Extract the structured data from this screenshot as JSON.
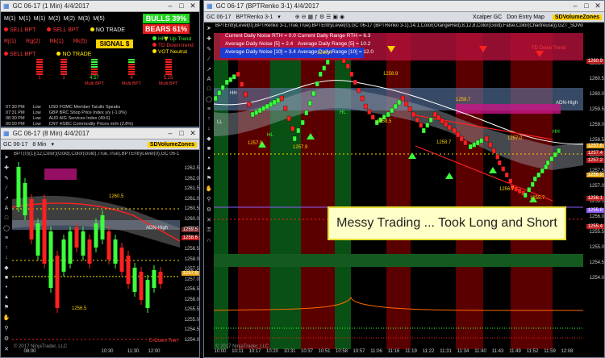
{
  "analyzer": {
    "title": "GC 06-17 (1 Min)  4/4/2017",
    "columns": [
      "M(1)",
      "M(1)",
      "M(1)",
      "M(2)",
      "M(2)",
      "M(3)",
      "M(5)"
    ],
    "rows": [
      {
        "items": [
          {
            "t": "SELL BPT",
            "c": "red"
          },
          {
            "t": "SELL BPT",
            "c": "red"
          },
          {
            "t": "NO TRADE",
            "c": "yel"
          }
        ]
      },
      {
        "items": [
          {
            "t": "Rj(1)",
            "c": "red"
          },
          {
            "t": "Rg(2)",
            "c": "red"
          },
          {
            "t": "Rk(1)",
            "c": "red"
          },
          {
            "t": "Rk(5)",
            "c": "red"
          }
        ]
      },
      {
        "items": [
          {
            "t": "SELL BPT",
            "c": "red"
          },
          {
            "t": "NO TRADE",
            "c": "yel"
          }
        ]
      }
    ],
    "bulls": "BULLS 39%",
    "bears": "BEARS 61%",
    "signal": "SIGNAL",
    "hft_up": "HFT Up Trend",
    "td_down": "TD Down trend",
    "vot_neutral": "VOT Neutral",
    "bar_values": [
      "1",
      "1",
      "4.57",
      "4",
      "5.25"
    ],
    "bar_labels": [
      "",
      "",
      "Multi BPT",
      "Multi BPT",
      "Multi BPT"
    ],
    "news": [
      [
        "07:30 PM",
        "Low",
        "USD FOMC Member Tarullo Speaks"
      ],
      [
        "07:31 PM",
        "Low",
        "GBP BRC Shop Price Index y/y (-1.0%)"
      ],
      [
        "08:30 PM",
        "Low",
        "AUD AIG Services Index (49.6)"
      ],
      [
        "09:00 PM",
        "Low",
        "CNY HSBC Commodity Prices m/m (2.8%)"
      ]
    ]
  },
  "small_chart": {
    "title": "GC 06-17 (8 Min)  4/4/2017",
    "toolbar": [
      "GC 06-17",
      "8 Min",
      "▾"
    ],
    "indicator": "BPT(0)(1)(12,Color)(Gold),Color(Gold),True,True),BPTEntryLevel(0),GC 06-17",
    "sdv": "SDVolumeZones",
    "prices": [
      "1262.5",
      "1262.0",
      "1261.5",
      "1261.0",
      "1260.5",
      "1260.0",
      "1259.5",
      "1259.0",
      "1258.5",
      "1258.0",
      "1257.5",
      "1257.0",
      "1256.5",
      "1256.0",
      "1255.5",
      "1255.0",
      "1254.5",
      "1254.0"
    ],
    "price_boxes": [
      {
        "v": "1259.5",
        "bg": "#7a2a2a"
      },
      {
        "v": "1258.6",
        "bg": "#b91c1c"
      },
      {
        "v": "1257.9",
        "bg": "#e8a81c"
      }
    ],
    "labels": {
      "adn_high": "ADN-High",
      "d_down": "D-Down Tren",
      "low": "1256.5",
      "mid": "1260.5"
    },
    "times": [
      "08:00",
      "10:30",
      "11:30",
      "12:00"
    ],
    "copyright": "© 2017 NinjaTrader, LLC"
  },
  "big_chart": {
    "title": "GC 06-17 (BPTRenko 3-1)  4/4/2017",
    "toolbar": [
      "GC 06-17",
      "BPTRenko 3-1",
      "▾"
    ],
    "xcalper": "Xcalper GC",
    "don_entry": "Don Entry Map",
    "sdv": "SDVolumeZones",
    "indicator": "BPTEntryLevel(0),BPTRenko 3-1,True,True),BPTEntryLevel(0),GC 06-17 (BPTRenko 3-1),14,1,Color(OrangeRed),8,12,8,Color(Gold),False,Color(Chartreuse)),GZT_SDVolumeZ",
    "noise": {
      "cur_noise": "Current Daily Noise RTH = 0.0",
      "cur_range": "Current Daily Range RTH = 6.3",
      "avg_noise5": "Average Daily Noise [5] = 2.4",
      "avg_range5": "Average Daily Range [5] = 10.2",
      "avg_noise10": "Average Daily Noise [10] = 3.4",
      "avg_range10": "Average Daily Range [10] = 12.0"
    },
    "prices": [
      "1261.0",
      "1260.5",
      "1260.0",
      "1259.5",
      "1259.0",
      "1258.5",
      "1258.0",
      "1257.5",
      "1257.0",
      "1256.5",
      "1256.0",
      "1255.5",
      "1255.0",
      "1254.5",
      "1254.0"
    ],
    "price_boxes": [
      {
        "v": "1260.9",
        "bg": "#b91c1c"
      },
      {
        "v": "1257.6",
        "bg": "#e8a81c"
      },
      {
        "v": "1257.4",
        "bg": "#b91c1c"
      },
      {
        "v": "1257.2",
        "bg": "#b91c1c"
      },
      {
        "v": "1256.9",
        "bg": "#e8a81c"
      },
      {
        "v": "1256.1",
        "bg": "#b91c1c"
      },
      {
        "v": "1255.8",
        "bg": "#8b5cf6"
      },
      {
        "v": "1255.4",
        "bg": "#b91c1c"
      }
    ],
    "labels": {
      "td_down": "TD Down Trend",
      "adn_high": "ADN-High",
      "hh": "HH",
      "hl": "HL",
      "hh2": "HH",
      "hl2": "HL",
      "ll": "LL",
      "p1": "1257.9",
      "p2": "1257.9",
      "p3": "1258.5",
      "p4": "1258.7",
      "p5": "1256.7",
      "p6": "1257.0",
      "p7": "1260.4",
      "p8": "1258.9",
      "p9": "1258.7",
      "p10": "1255.7"
    },
    "times": [
      "10:00",
      "10:11",
      "10:17",
      "10:20",
      "10:31",
      "10:37",
      "10:51",
      "10:58",
      "10:57",
      "11:06",
      "11:16",
      "11:19",
      "11:22",
      "11:31",
      "11:34",
      "11:40",
      "11:43",
      "11:49",
      "11:52",
      "11:59",
      "12:08"
    ],
    "callout": "Messy Trading ... Took Long and Short",
    "copyright": "© 2017 NinjaTrader, LLC"
  },
  "colors": {
    "bull": "#3cff3c",
    "bear": "#ff2020",
    "gold": "#ffd200",
    "accent": "#2a3db8"
  }
}
